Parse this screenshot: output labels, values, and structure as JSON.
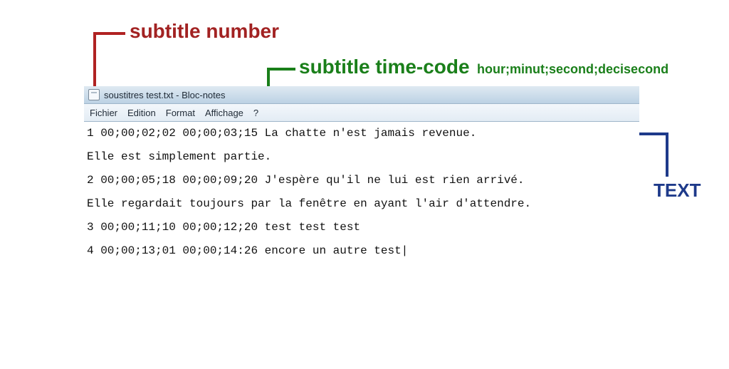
{
  "annotations": {
    "subtitle_number": "subtitle number",
    "subtitle_timecode": "subtitle time-code",
    "timecode_detail": "hour;minut;second;decisecond",
    "text_label": "TEXT"
  },
  "window": {
    "title": "soustitres test.txt - Bloc-notes",
    "menu": {
      "file": "Fichier",
      "edit": "Edition",
      "format": "Format",
      "view": "Affichage",
      "help": "?"
    }
  },
  "lines": {
    "l1": "1 00;00;02;02 00;00;03;15 La chatte n'est jamais revenue.",
    "l2": "Elle est simplement partie.",
    "l3": "2 00;00;05;18 00;00;09;20 J'espère qu'il ne lui est rien arrivé.",
    "l4": "Elle regardait toujours par la fenêtre en ayant l'air d'attendre.",
    "l5": "3 00;00;11;10 00;00;12;20 test test test",
    "l6": "4 00;00;13;01 00;00;14:26 encore un autre test|"
  },
  "subtitles": [
    {
      "index": 1,
      "start": "00;00;02;02",
      "end": "00;00;03;15",
      "text": "La chatte n'est jamais revenue. Elle est simplement partie."
    },
    {
      "index": 2,
      "start": "00;00;05;18",
      "end": "00;00;09;20",
      "text": "J'espère qu'il ne lui est rien arrivé. Elle regardait toujours par la fenêtre en ayant l'air d'attendre."
    },
    {
      "index": 3,
      "start": "00;00;11;10",
      "end": "00;00;12;20",
      "text": "test test test"
    },
    {
      "index": 4,
      "start": "00;00;13;01",
      "end": "00;00;14:26",
      "text": "encore un autre test"
    }
  ],
  "colors": {
    "red": "#a22222",
    "green": "#1a7f1a",
    "blue": "#1e3a8a"
  }
}
